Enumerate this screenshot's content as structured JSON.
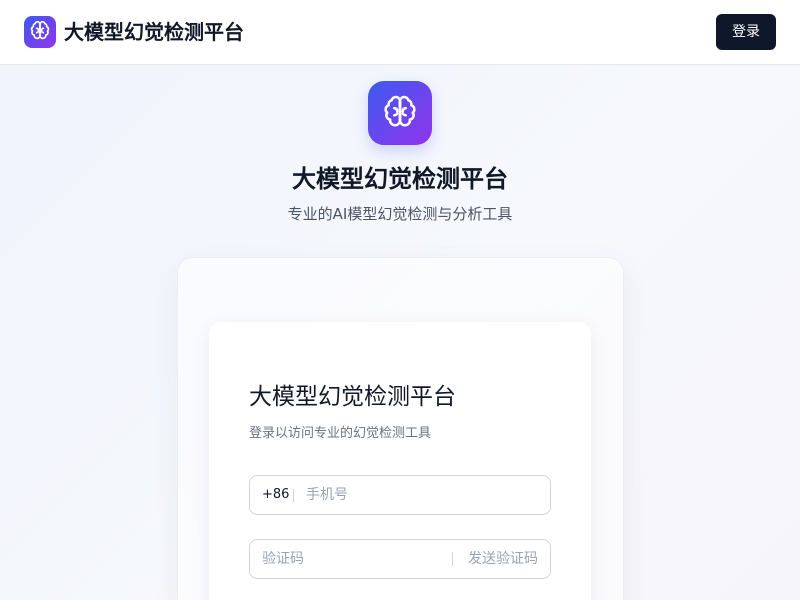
{
  "header": {
    "logo_icon": "brain-icon",
    "title": "大模型幻觉检测平台",
    "login_label": "登录"
  },
  "hero": {
    "logo_icon": "brain-icon",
    "title": "大模型幻觉检测平台",
    "subtitle": "专业的AI模型幻觉检测与分析工具"
  },
  "login_form": {
    "title": "大模型幻觉检测平台",
    "subtitle": "登录以访问专业的幻觉检测工具",
    "phone": {
      "prefix": "+86",
      "placeholder": "手机号",
      "value": ""
    },
    "code": {
      "placeholder": "验证码",
      "value": "",
      "send_label": "发送验证码"
    }
  },
  "colors": {
    "brand_gradient_start": "#3b5bf0",
    "brand_gradient_end": "#9333ea",
    "primary_button": "#0f172a"
  }
}
